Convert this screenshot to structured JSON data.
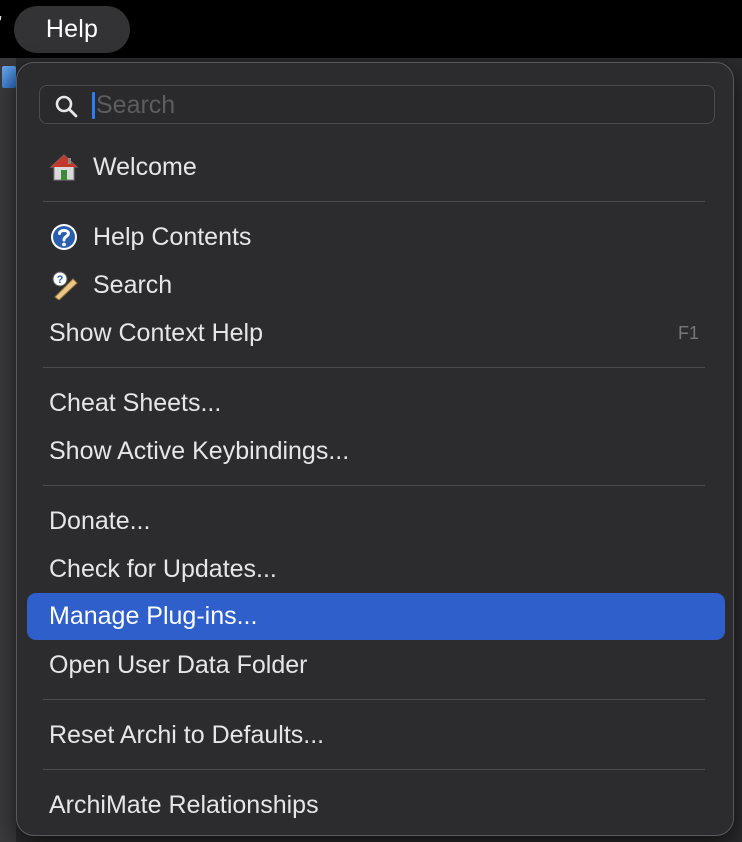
{
  "menubar": {
    "edge_glyph": "’",
    "help_title": "Help"
  },
  "search": {
    "placeholder": "Search"
  },
  "menu": {
    "items": [
      {
        "label": "Welcome",
        "icon": "house-icon"
      },
      {
        "label": "Help Contents",
        "icon": "question-mark-circle-icon"
      },
      {
        "label": "Search",
        "icon": "help-search-icon"
      },
      {
        "label": "Show Context Help",
        "shortcut": "F1"
      },
      {
        "label": "Cheat Sheets..."
      },
      {
        "label": "Show Active Keybindings..."
      },
      {
        "label": "Donate..."
      },
      {
        "label": "Check for Updates..."
      },
      {
        "label": "Manage Plug-ins...",
        "highlighted": true
      },
      {
        "label": "Open User Data Folder"
      },
      {
        "label": "Reset Archi to Defaults..."
      },
      {
        "label": "ArchiMate Relationships"
      }
    ]
  },
  "colors": {
    "menubar_bg": "#000000",
    "panel_bg": "#2c2c2e",
    "highlight": "#2f5fca",
    "caret": "#2d7cf6"
  }
}
